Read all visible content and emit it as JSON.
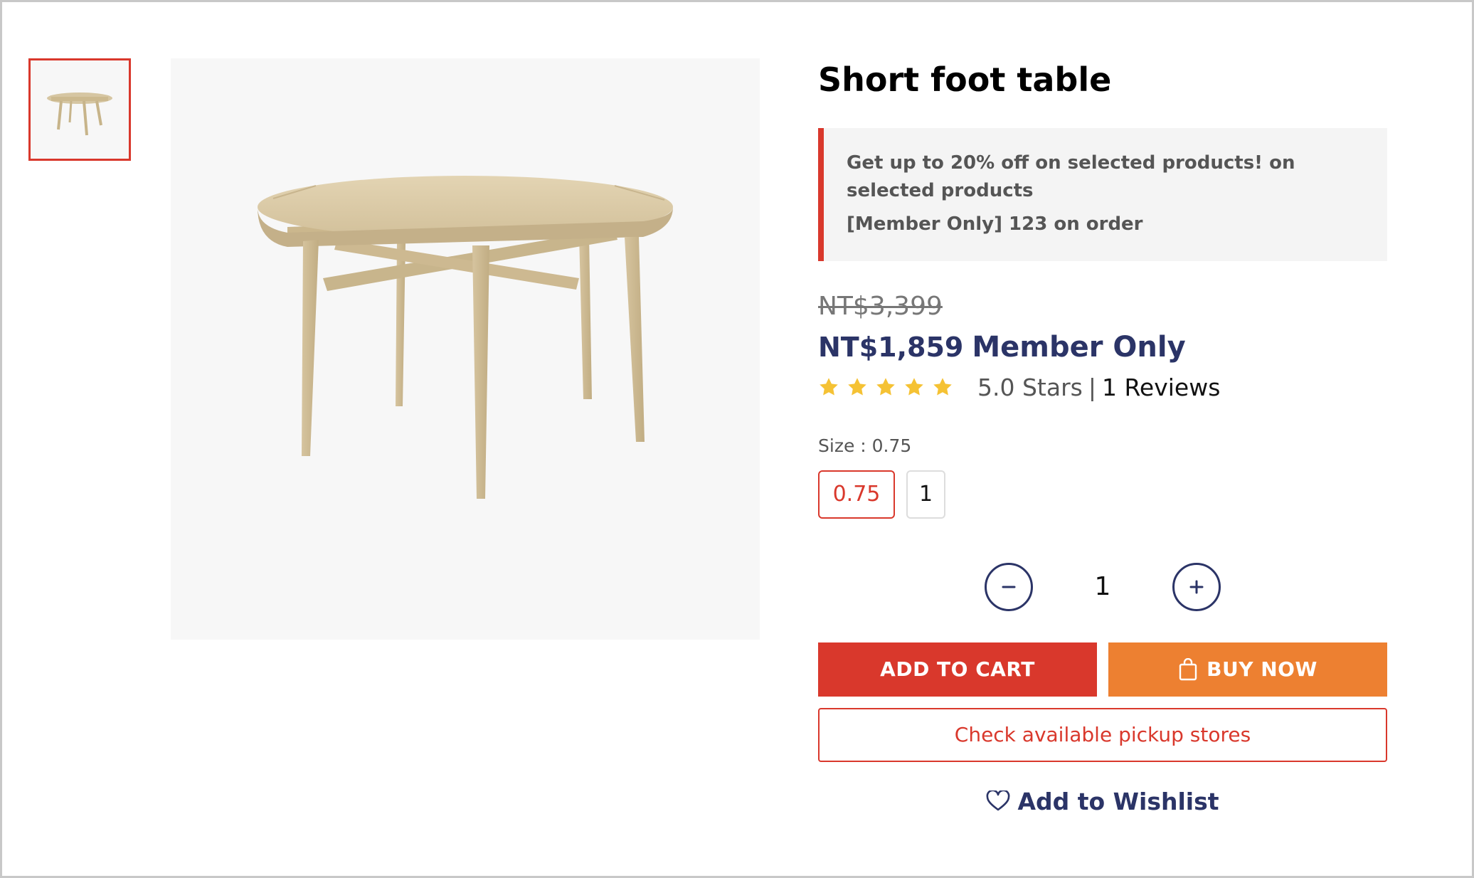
{
  "product": {
    "title": "Short foot table",
    "image_alt": "Short foot table product image",
    "thumbnail_alt": "Short foot table thumbnail"
  },
  "promo": {
    "line1": "Get up to 20% off on selected products! on selected products",
    "line2": "[Member Only] 123 on order"
  },
  "price": {
    "original": "NT$3,399",
    "current": "NT$1,859",
    "member_label": "Member Only"
  },
  "rating": {
    "stars_filled": 5,
    "stars_total": 5,
    "text": "5.0 Stars",
    "separator": "|",
    "reviews": "1 Reviews"
  },
  "size": {
    "label": "Size : 0.75",
    "options": [
      "0.75",
      "1"
    ],
    "selected": "0.75"
  },
  "quantity": {
    "value": "1"
  },
  "actions": {
    "add_to_cart": "ADD TO CART",
    "buy_now": "BUY NOW",
    "pickup": "Check available pickup stores",
    "wishlist": "Add to Wishlist"
  },
  "colors": {
    "accent_red": "#d9382c",
    "accent_orange": "#ed8031",
    "navy": "#2b3467",
    "star_yellow": "#f5c234"
  },
  "icons": {
    "star": "star-icon",
    "minus": "minus-icon",
    "plus": "plus-icon",
    "bag": "shopping-bag-icon",
    "heart": "heart-icon"
  }
}
